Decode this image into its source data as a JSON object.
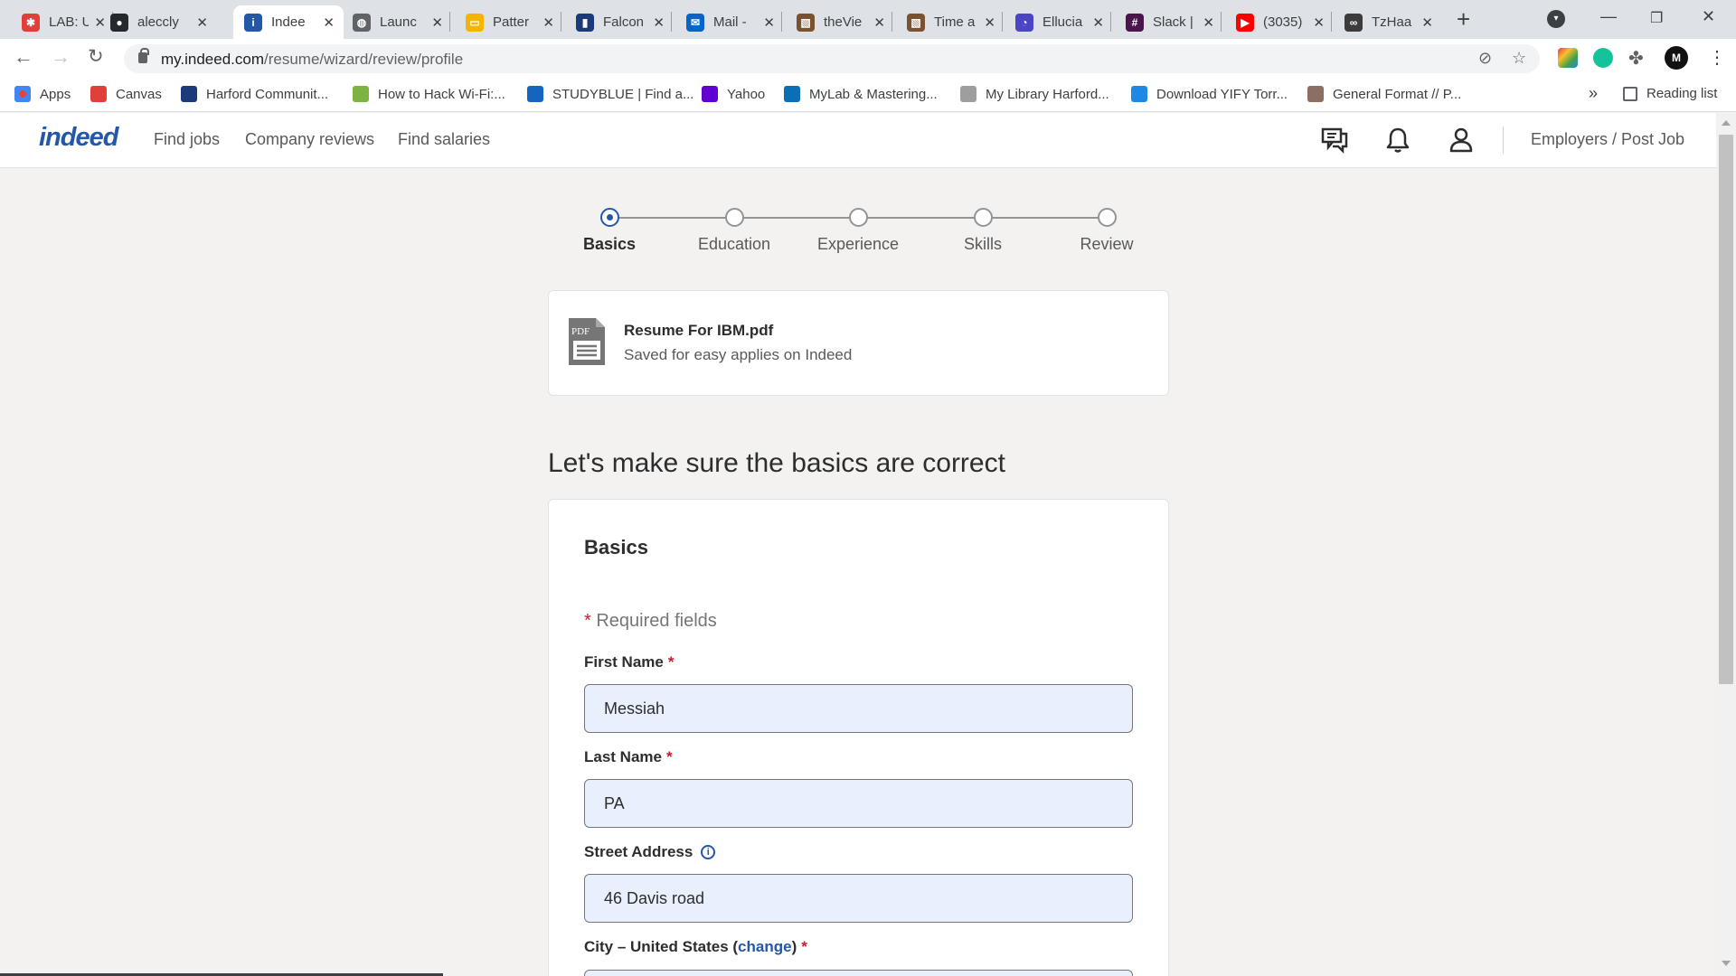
{
  "browser": {
    "tabs": [
      {
        "title": "LAB: U",
        "color": "#e0403a",
        "glyph": "✱"
      },
      {
        "title": "aleccly",
        "color": "#24292e",
        "glyph": "●"
      },
      {
        "title": "Indee",
        "color": "#2557a7",
        "glyph": "i"
      },
      {
        "title": "Launc",
        "color": "#5f6368",
        "glyph": "◍"
      },
      {
        "title": "Patter",
        "color": "#f4b400",
        "glyph": "▭"
      },
      {
        "title": "Falcon",
        "color": "#1a3a7a",
        "glyph": "▮"
      },
      {
        "title": "Mail -",
        "color": "#0a64c8",
        "glyph": "✉"
      },
      {
        "title": "theVie",
        "color": "#7a5230",
        "glyph": "▧"
      },
      {
        "title": "Time a",
        "color": "#7a5230",
        "glyph": "▧"
      },
      {
        "title": "Ellucia",
        "color": "#4b45c6",
        "glyph": "◔"
      },
      {
        "title": "Slack |",
        "color": "#4a154b",
        "glyph": "#"
      },
      {
        "title": "(3035)",
        "color": "#ff0000",
        "glyph": "▶"
      },
      {
        "title": "TzHaa",
        "color": "#3c3c3c",
        "glyph": "∞"
      }
    ],
    "url_host": "my.indeed.com",
    "url_path": "/resume/wizard/review/profile",
    "bookmarks": [
      {
        "label": "Apps",
        "color": "#ea4335"
      },
      {
        "label": "Canvas",
        "color": "#e0403a"
      },
      {
        "label": "Harford Communit...",
        "color": "#1a3a7a"
      },
      {
        "label": "How to Hack Wi-Fi:...",
        "color": "#7cb342"
      },
      {
        "label": "STUDYBLUE | Find a...",
        "color": "#1565c0"
      },
      {
        "label": "Yahoo",
        "color": "#6001d2"
      },
      {
        "label": "MyLab & Mastering...",
        "color": "#0a6fb5"
      },
      {
        "label": "My Library Harford...",
        "color": "#9e9e9e"
      },
      {
        "label": "Download YIFY Torr...",
        "color": "#1e88e5"
      },
      {
        "label": "General Format // P...",
        "color": "#8d6e63"
      }
    ],
    "bookmarks_more": "»",
    "reading_list": "Reading list"
  },
  "header": {
    "logo": "indeed",
    "nav": [
      "Find jobs",
      "Company reviews",
      "Find salaries"
    ],
    "employers": "Employers / Post Job"
  },
  "stepper": {
    "steps": [
      "Basics",
      "Education",
      "Experience",
      "Skills",
      "Review"
    ],
    "active_index": 0
  },
  "resume": {
    "icon_text": "PDF",
    "file_name": "Resume For IBM.pdf",
    "subtitle": "Saved for easy applies on Indeed"
  },
  "page_heading": "Let's make sure the basics are correct",
  "form": {
    "title": "Basics",
    "required_note": "Required fields",
    "required_star": "*",
    "first_name_label": "First Name",
    "first_name_value": "Messiah",
    "last_name_label": "Last Name",
    "last_name_value": "PA",
    "street_label": "Street Address",
    "street_value": "46 Davis road",
    "city_label": "City – United States (",
    "city_change": "change",
    "city_label_end": ")"
  },
  "colors": {
    "brand": "#2557a7",
    "required": "#c91b2e",
    "field_fill": "#e8f0fe"
  }
}
